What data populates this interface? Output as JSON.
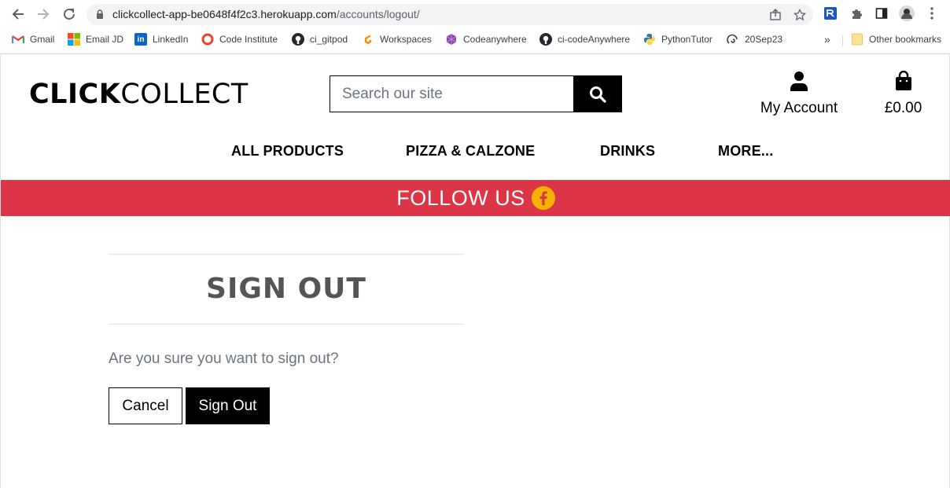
{
  "browser": {
    "url_host": "clickcollect-app-be0648f4f2c3.herokuapp.com",
    "url_path": "/accounts/logout/",
    "bookmarks": [
      {
        "label": "Gmail",
        "icon": "gmail-icon"
      },
      {
        "label": "Email JD",
        "icon": "microsoft-icon"
      },
      {
        "label": "LinkedIn",
        "icon": "linkedin-icon"
      },
      {
        "label": "Code Institute",
        "icon": "code-institute-icon"
      },
      {
        "label": "ci_gitpod",
        "icon": "github-icon"
      },
      {
        "label": "Workspaces",
        "icon": "gitpod-icon"
      },
      {
        "label": "Codeanywhere",
        "icon": "codeanywhere-icon"
      },
      {
        "label": "ci-codeAnywhere",
        "icon": "github-icon"
      },
      {
        "label": "PythonTutor",
        "icon": "python-icon"
      },
      {
        "label": "20Sep23",
        "icon": "swirl-icon"
      }
    ],
    "overflow": "»",
    "other_bookmarks": "Other bookmarks"
  },
  "header": {
    "logo_bold": "CLICK",
    "logo_light": "COLLECT",
    "search_placeholder": "Search our site",
    "account_label": "My Account",
    "bag_total": "£0.00"
  },
  "nav": {
    "items": [
      "ALL PRODUCTS",
      "PIZZA & CALZONE",
      "DRINKS",
      "MORE..."
    ]
  },
  "banner": {
    "text": "FOLLOW US",
    "color": "#dc3545",
    "icon_color": "#f5b100"
  },
  "main": {
    "title": "SIGN OUT",
    "question": "Are you sure you want to sign out?",
    "cancel_label": "Cancel",
    "signout_label": "Sign Out"
  }
}
